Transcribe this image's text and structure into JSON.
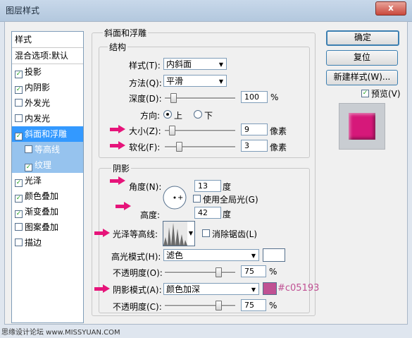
{
  "window": {
    "title": "图层样式",
    "close_label": "x"
  },
  "stylelist": {
    "header": "样式",
    "blend": "混合选项:默认",
    "items": [
      {
        "label": "投影",
        "checked": "✓"
      },
      {
        "label": "内阴影",
        "checked": "✓"
      },
      {
        "label": "外发光",
        "checked": ""
      },
      {
        "label": "内发光",
        "checked": ""
      },
      {
        "label": "斜面和浮雕",
        "checked": "✓"
      },
      {
        "label": "等高线",
        "checked": ""
      },
      {
        "label": "纹理",
        "checked": "✓"
      },
      {
        "label": "光泽",
        "checked": "✓"
      },
      {
        "label": "颜色叠加",
        "checked": "✓"
      },
      {
        "label": "渐变叠加",
        "checked": "✓"
      },
      {
        "label": "图案叠加",
        "checked": ""
      },
      {
        "label": "描边",
        "checked": ""
      }
    ]
  },
  "bevel": {
    "section_title": "斜面和浮雕",
    "structure_title": "结构",
    "style_label": "样式(T):",
    "style_value": "内斜面",
    "technique_label": "方法(Q):",
    "technique_value": "平滑",
    "depth_label": "深度(D):",
    "depth_value": "100",
    "depth_unit": "%",
    "direction_label": "方向:",
    "dir_up": "上",
    "dir_down": "下",
    "size_label": "大小(Z):",
    "size_value": "9",
    "size_unit": "像素",
    "soften_label": "软化(F):",
    "soften_value": "3",
    "soften_unit": "像素"
  },
  "shading": {
    "title": "阴影",
    "angle_label": "角度(N):",
    "angle_value": "13",
    "angle_unit": "度",
    "global_light_label": "使用全局光(G)",
    "altitude_label": "高度:",
    "altitude_value": "42",
    "altitude_unit": "度",
    "gloss_label": "光泽等高线:",
    "antialias_label": "消除锯齿(L)",
    "highlight_mode_label": "高光模式(H):",
    "highlight_mode_value": "滤色",
    "highlight_color": "#ffffff",
    "highlight_opacity_label": "不透明度(O):",
    "highlight_opacity_value": "75",
    "highlight_opacity_unit": "%",
    "shadow_mode_label": "阴影模式(A):",
    "shadow_mode_value": "颜色加深",
    "shadow_color": "#c05193",
    "shadow_color_note": "#c05193",
    "shadow_opacity_label": "不透明度(C):",
    "shadow_opacity_value": "75",
    "shadow_opacity_unit": "%"
  },
  "buttons": {
    "ok": "确定",
    "reset": "复位",
    "new_style": "新建样式(W)...",
    "preview": "预览(V)"
  },
  "preview_color": "#d6187a",
  "watermark": "思缘设计论坛 www.MISSYUAN.COM"
}
